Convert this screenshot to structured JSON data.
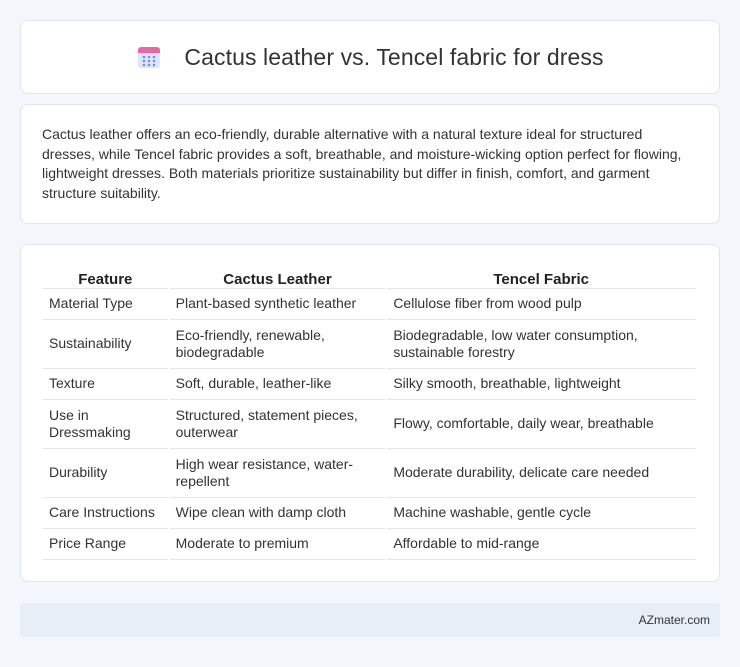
{
  "header": {
    "title": "Cactus leather vs. Tencel fabric for dress",
    "icon": "calendar-icon",
    "icon_colors": {
      "top": "#e66aa0",
      "body": "#dbe6ff",
      "dots": "#7a8be0"
    }
  },
  "summary": {
    "text": "Cactus leather offers an eco-friendly, durable alternative with a natural texture ideal for structured dresses, while Tencel fabric provides a soft, breathable, and moisture-wicking option perfect for flowing, lightweight dresses. Both materials prioritize sustainability but differ in finish, comfort, and garment structure suitability."
  },
  "table": {
    "headers": [
      "Feature",
      "Cactus Leather",
      "Tencel Fabric"
    ],
    "rows": [
      [
        "Material Type",
        "Plant-based synthetic leather",
        "Cellulose fiber from wood pulp"
      ],
      [
        "Sustainability",
        "Eco-friendly, renewable, biodegradable",
        "Biodegradable, low water consumption, sustainable forestry"
      ],
      [
        "Texture",
        "Soft, durable, leather-like",
        "Silky smooth, breathable, lightweight"
      ],
      [
        "Use in Dressmaking",
        "Structured, statement pieces, outerwear",
        "Flowy, comfortable, daily wear, breathable"
      ],
      [
        "Durability",
        "High wear resistance, water-repellent",
        "Moderate durability, delicate care needed"
      ],
      [
        "Care Instructions",
        "Wipe clean with damp cloth",
        "Machine washable, gentle cycle"
      ],
      [
        "Price Range",
        "Moderate to premium",
        "Affordable to mid-range"
      ]
    ]
  },
  "footer": {
    "brand": "AZmater.com"
  }
}
